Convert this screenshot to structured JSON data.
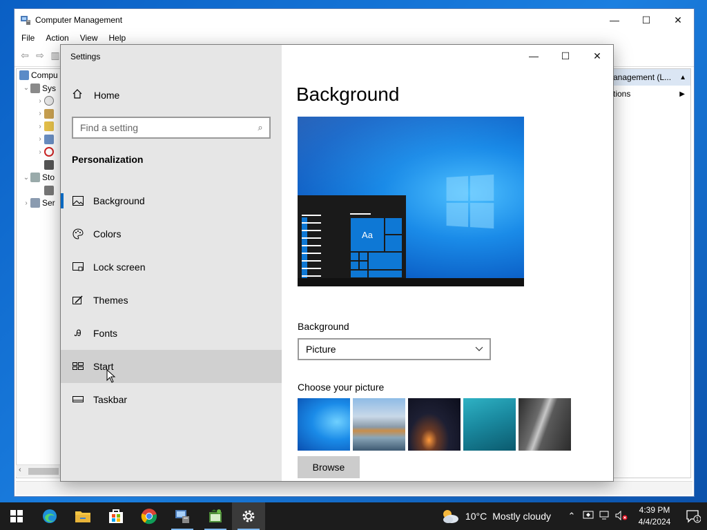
{
  "computer_management": {
    "title": "Computer Management",
    "menu": [
      "File",
      "Action",
      "View",
      "Help"
    ],
    "tree": [
      {
        "label": "Compu",
        "indent": 0,
        "chev": ""
      },
      {
        "label": "Sys",
        "indent": 1,
        "chev": "⌄"
      },
      {
        "label": "",
        "indent": 2,
        "chev": "›"
      },
      {
        "label": "",
        "indent": 2,
        "chev": "›"
      },
      {
        "label": "",
        "indent": 2,
        "chev": "›"
      },
      {
        "label": "",
        "indent": 2,
        "chev": "›"
      },
      {
        "label": "",
        "indent": 2,
        "chev": "›"
      },
      {
        "label": "",
        "indent": 2,
        "chev": ""
      },
      {
        "label": "Sto",
        "indent": 1,
        "chev": "⌄"
      },
      {
        "label": "",
        "indent": 2,
        "chev": ""
      },
      {
        "label": "Ser",
        "indent": 1,
        "chev": "›"
      }
    ],
    "actions_header": "anagement (L...",
    "actions_row": "tions"
  },
  "settings": {
    "title": "Settings",
    "home_label": "Home",
    "search_placeholder": "Find a setting",
    "section": "Personalization",
    "nav_items": [
      {
        "label": "Background",
        "icon": "picture-icon"
      },
      {
        "label": "Colors",
        "icon": "palette-icon"
      },
      {
        "label": "Lock screen",
        "icon": "lock-screen-icon"
      },
      {
        "label": "Themes",
        "icon": "themes-icon"
      },
      {
        "label": "Fonts",
        "icon": "fonts-icon"
      },
      {
        "label": "Start",
        "icon": "start-icon"
      },
      {
        "label": "Taskbar",
        "icon": "taskbar-icon"
      }
    ],
    "page_title": "Background",
    "preview_tile_text": "Aa",
    "background_label": "Background",
    "background_value": "Picture",
    "choose_label": "Choose your picture",
    "browse_label": "Browse",
    "accent_color": "#0067c0"
  },
  "taskbar": {
    "apps": [
      "start-icon",
      "edge-icon",
      "file-explorer-icon",
      "store-icon",
      "chrome-icon",
      "computer-management-icon",
      "task-scheduler-icon",
      "settings-icon"
    ],
    "weather_temp": "10°C",
    "weather_text": "Mostly cloudy",
    "time": "4:39 PM",
    "date": "4/4/2024",
    "notification_count": "1"
  }
}
